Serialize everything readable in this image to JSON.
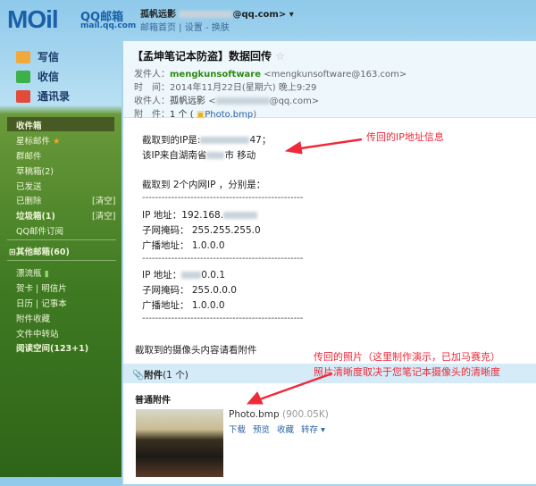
{
  "header": {
    "logo": "MOil",
    "logo_cn": "QQ邮箱",
    "logo_domain": "mail.qq.com",
    "user_name": "孤帆远影",
    "user_email_suffix": "@qq.com>",
    "dropdown": "▾",
    "links": [
      "邮箱首页",
      "设置",
      "换肤"
    ]
  },
  "nav": [
    {
      "label": "写信",
      "icon": "compose-icon"
    },
    {
      "label": "收信",
      "icon": "inbox-download-icon"
    },
    {
      "label": "通讯录",
      "icon": "contacts-icon"
    }
  ],
  "sidebar": {
    "folders": [
      "收件箱",
      "星标邮件",
      "群邮件",
      "草稿箱(2)",
      "已发送",
      "已删除",
      "垃圾箱(1)",
      "QQ邮件订阅"
    ],
    "clear": "[清空]",
    "other": "其他邮箱(60)",
    "tools": [
      "漂流瓶",
      "贺卡",
      "明信片",
      "日历",
      "记事本",
      "附件收藏",
      "文件中转站",
      "阅读空间(123+1)"
    ]
  },
  "mail": {
    "subject": "【孟坤笔记本防盗】数据回传",
    "from_label": "发件人：",
    "from_name": "mengkunsoftware",
    "from_addr": "<mengkunsoftware@163.com>",
    "time_label": "时　间：",
    "time": "2014年11月22日(星期六) 晚上9:29",
    "to_label": "收件人：",
    "to_name": "孤帆远影",
    "to_addr_pre": "<",
    "to_addr_suf": "@qq.com>",
    "att_label": "附　件：",
    "att_count": "1 个 (",
    "att_name": "Photo.bmp",
    "att_close": ")",
    "body": {
      "ip_line_pre": "截取到的IP是:",
      "ip_line_suf": "47；",
      "loc_pre": "该IP来自湖南省",
      "loc_suf": "市 移动",
      "lan_intro": "截取到 2个内网IP ，分别是：",
      "dashes": "--------------------------------------------------",
      "ip1_label": "IP 地址：192.168.",
      "mask1": "子网掩码：  255.255.255.0",
      "bc1": "广播地址：  1.0.0.0",
      "ip2_label": "IP 地址：",
      "ip2_suf": "0.0.1",
      "mask2": "子网掩码：  255.0.0.0",
      "bc2": "广播地址：  1.0.0.0",
      "camera": "截取到的摄像头内容请看附件"
    },
    "attachments": {
      "header": "附件",
      "count": "(1 个)",
      "section": "普通附件",
      "file": "Photo.bmp",
      "size": "(900.05K)",
      "actions": [
        "下载",
        "预览",
        "收藏",
        "转存 ▾"
      ]
    }
  },
  "annotations": {
    "ip_note": "传回的IP地址信息",
    "photo_note1": "传回的照片（这里制作演示，已加马赛克）",
    "photo_note2": "照片清晰度取决于您笔记本摄像头的清晰度",
    "color": "#f0293a"
  }
}
